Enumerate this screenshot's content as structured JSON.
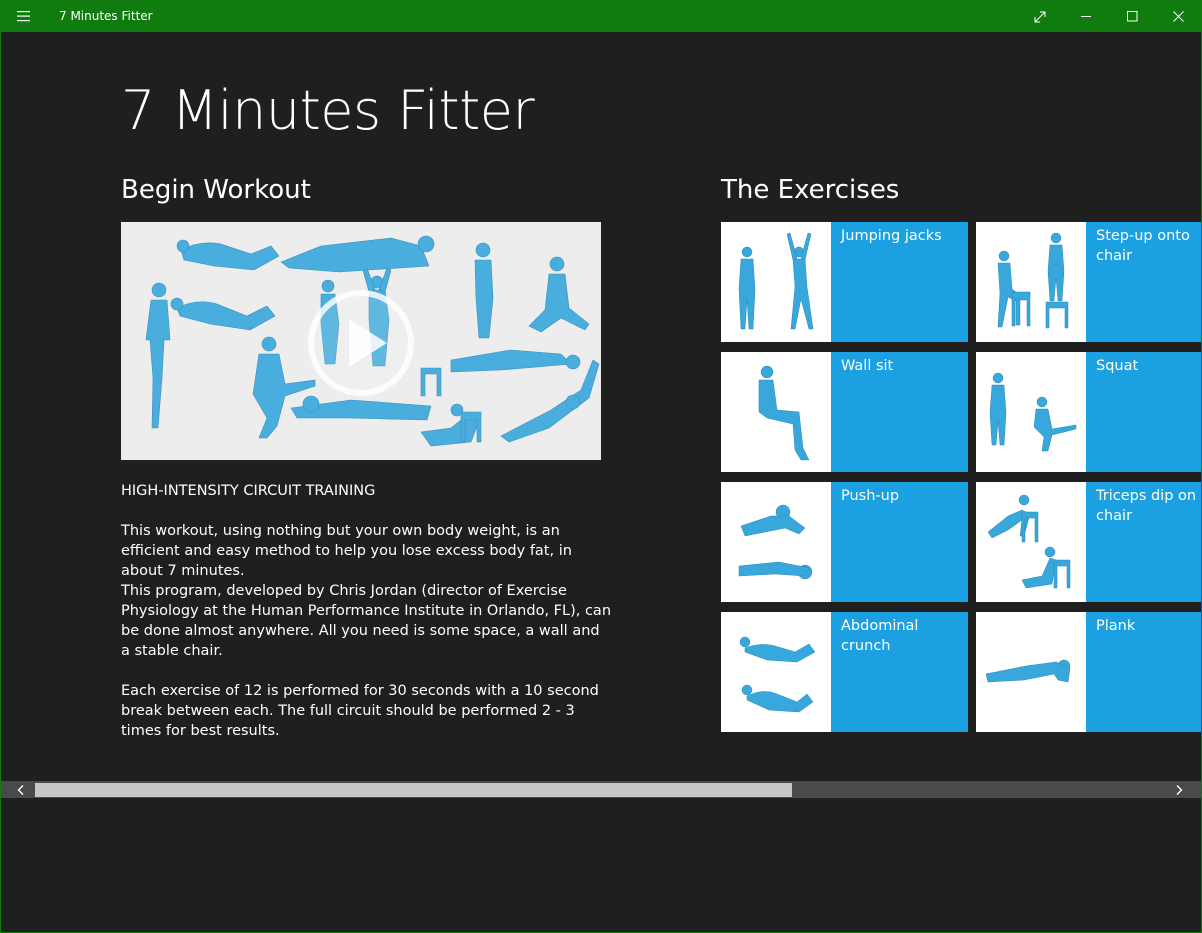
{
  "window": {
    "app_title": "7 Minutes Fitter",
    "accent_color": "#107c10",
    "icons": [
      "hamburger-menu-icon",
      "fullscreen-icon",
      "minimize-icon",
      "maximize-icon",
      "close-icon"
    ]
  },
  "main": {
    "title": "7 Minutes Fitter"
  },
  "workout": {
    "heading": "Begin Workout",
    "play_icon": "play-icon",
    "subtitle": "HIGH-INTENSITY CIRCUIT TRAINING",
    "paragraph1": "This workout, using nothing but your own body weight, is an efficient and easy method to help you lose excess body fat, in about 7 minutes.",
    "paragraph2": "This program, developed by Chris Jordan (director of Exercise Physiology at the Human Performance Institute in Orlando, FL), can be done almost anywhere. All you need is some space, a wall and a stable chair.",
    "paragraph3": "Each exercise of 12 is performed for 30 seconds with a 10 second break between each. The full circuit should be performed 2 - 3 times for best results."
  },
  "exercises": {
    "heading": "The Exercises",
    "tile_color": "#1ba1e2",
    "items": [
      {
        "label": "Jumping jacks"
      },
      {
        "label": "Step-up onto chair"
      },
      {
        "label": "Wall sit"
      },
      {
        "label": "Squat"
      },
      {
        "label": "Push-up"
      },
      {
        "label": "Triceps dip on chair"
      },
      {
        "label": "Abdominal crunch"
      },
      {
        "label": "Plank"
      }
    ]
  },
  "scrollbar": {
    "left_icon": "chevron-left-icon",
    "right_icon": "chevron-right-icon"
  }
}
